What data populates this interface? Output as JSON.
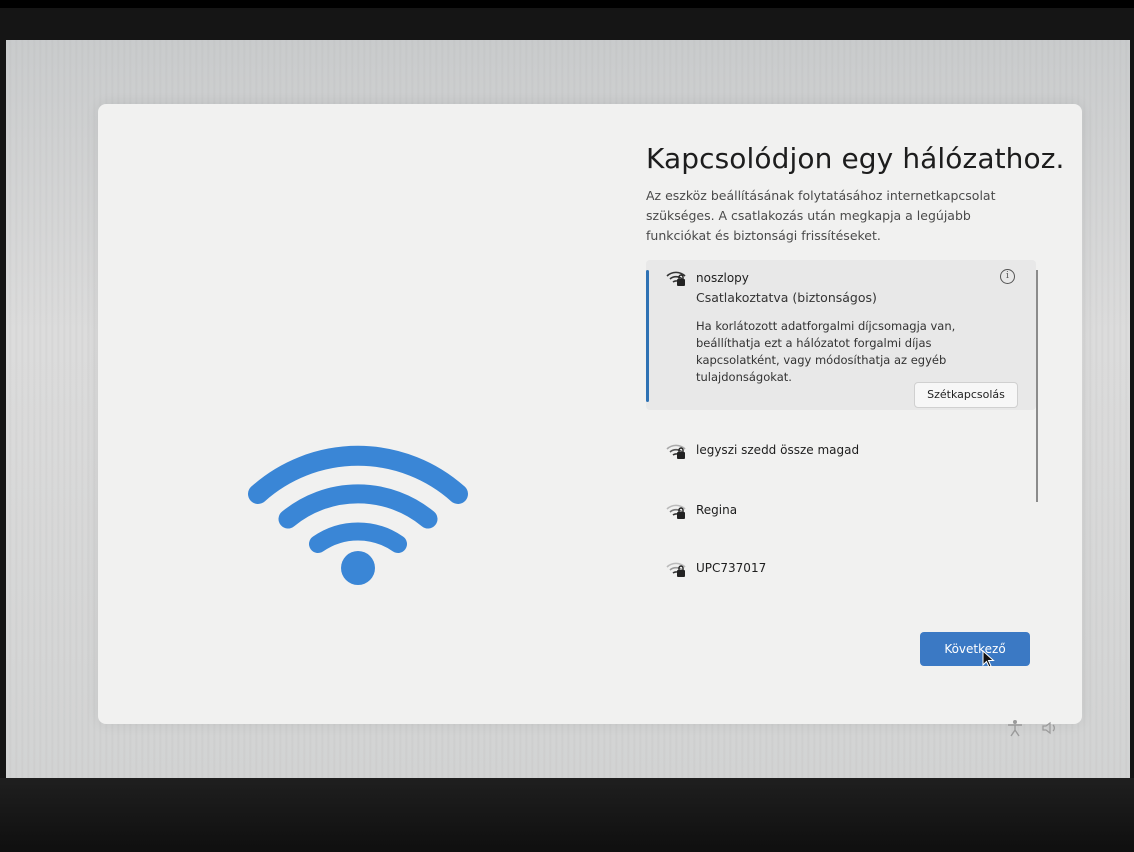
{
  "dialog": {
    "title": "Kapcsolódjon egy hálózathoz.",
    "description": "Az eszköz beállításának folytatásához internetkapcsolat szükséges. A csatlakozás után megkapja a legújabb funkciókat és biztonsági frissítéseket."
  },
  "networks": {
    "selected": {
      "name": "noszlopy",
      "status": "Csatlakoztatva (biztonságos)",
      "note": "Ha korlátozott adatforgalmi díjcsomagja van, beállíthatja ezt a hálózatot forgalmi díjas kapcsolatként, vagy módosíthatja az egyéb tulajdonságokat.",
      "info_icon": "info-icon",
      "disconnect_label": "Szétkapcsolás"
    },
    "items": [
      {
        "name": "legyszi szedd össze magad"
      },
      {
        "name": "Regina"
      },
      {
        "name": "UPC737017"
      }
    ]
  },
  "actions": {
    "next_label": "Következő"
  },
  "colors": {
    "accent": "#3b79c4",
    "wifi_illustration": "#3a86d6"
  },
  "icons": [
    "wifi-secured-icon",
    "wifi-illustration-icon",
    "info-icon",
    "mouse-pointer-icon",
    "accessibility-icon",
    "volume-icon"
  ]
}
